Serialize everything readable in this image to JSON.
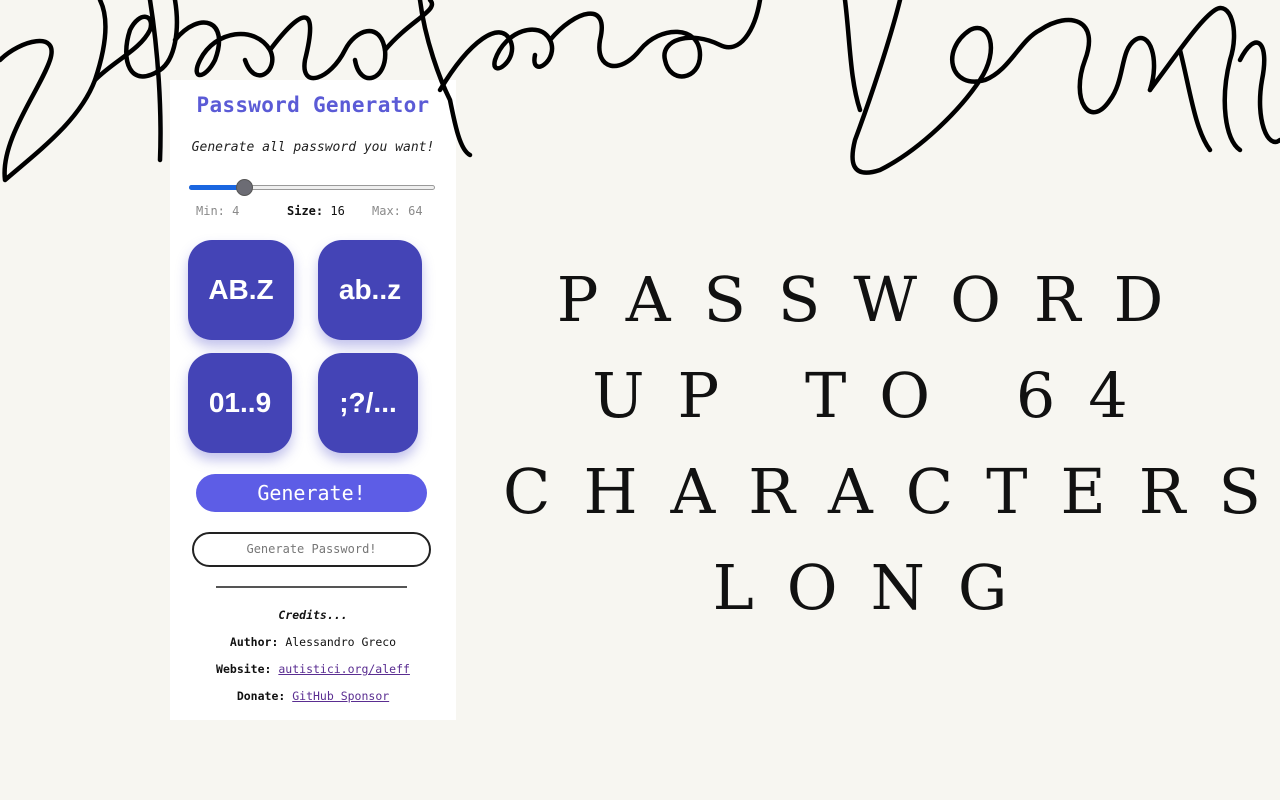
{
  "signature": {
    "text": "Sebastiano Beretta"
  },
  "popup": {
    "title": "Password Generator",
    "subtitle": "Generate all password you want!",
    "slider": {
      "min": 4,
      "max": 64,
      "value": 16,
      "min_label": "Min: 4",
      "size_key": "Size:",
      "size_value": "16",
      "max_label": "Max: 64"
    },
    "charsets": [
      {
        "label": "AB.Z"
      },
      {
        "label": "ab..z"
      },
      {
        "label": "01..9"
      },
      {
        "label": ";?/..."
      }
    ],
    "generate_label": "Generate!",
    "output_placeholder": "Generate Password!",
    "credits": {
      "heading": "Credits...",
      "author_key": "Author:",
      "author_value": "Alessandro Greco",
      "website_key": "Website:",
      "website_link": "autistici.org/aleff",
      "donate_key": "Donate:",
      "donate_link": "GitHub Sponsor"
    }
  },
  "headline": {
    "lines": [
      "PASSWORD",
      "UP TO 64",
      "CHARACTERS",
      "LONG"
    ]
  },
  "colors": {
    "background": "#f7f6f1",
    "accent": "#5d5de6",
    "charset_button": "#4444b6",
    "slider_fill": "#1a66e0"
  }
}
